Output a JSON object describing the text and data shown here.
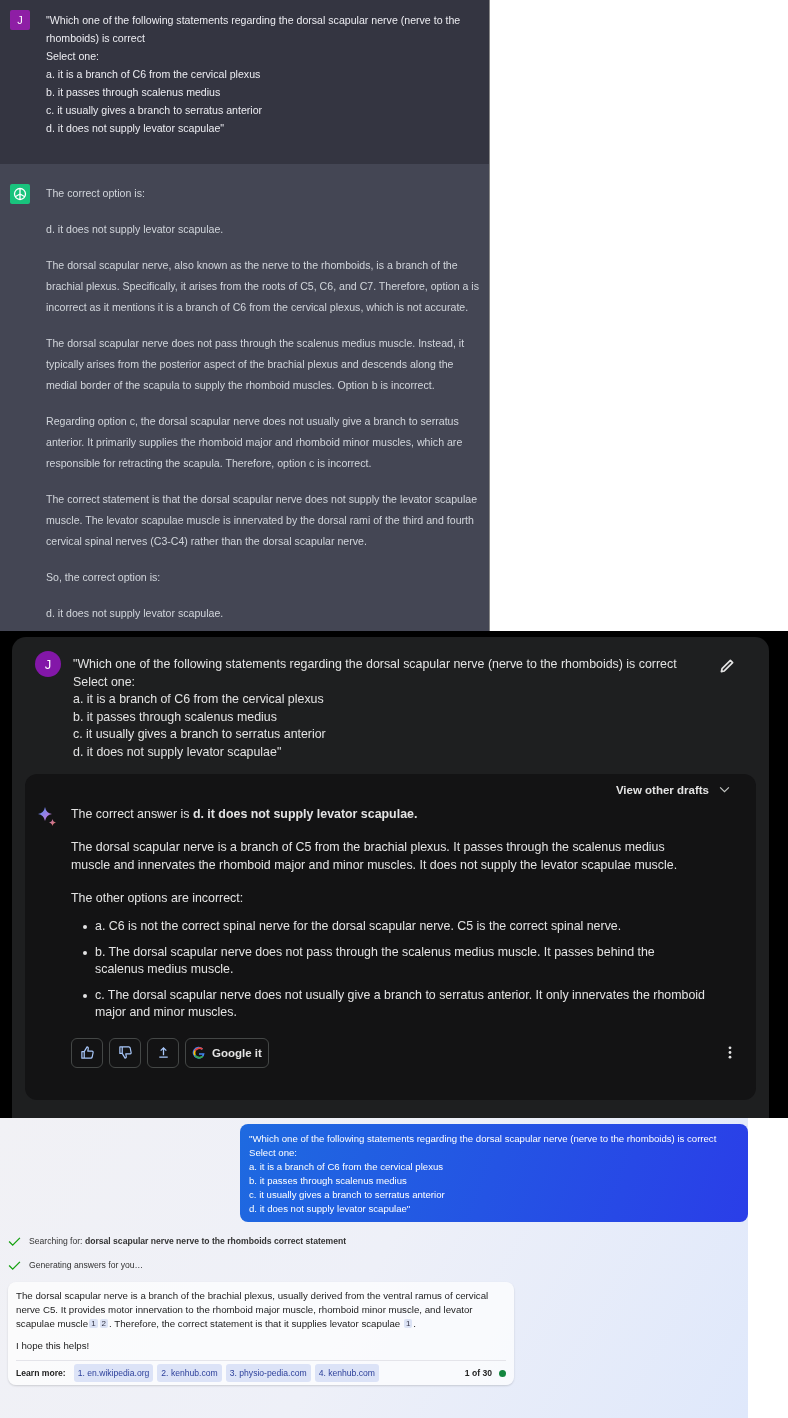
{
  "chatgpt": {
    "user": {
      "avatar": "J",
      "lines": [
        "\"Which one of the following statements regarding the dorsal scapular nerve (nerve to the rhomboids) is correct",
        "Select one:",
        "a. it is a branch of C6 from the cervical plexus",
        "b. it passes through scalenus medius",
        "c. it usually gives a branch to serratus anterior",
        "d. it does not supply levator scapulae\""
      ]
    },
    "answer": [
      "The correct option is:",
      "d. it does not supply levator scapulae.",
      "The dorsal scapular nerve, also known as the nerve to the rhomboids, is a branch of the brachial plexus. Specifically, it arises from the roots of C5, C6, and C7. Therefore, option a is incorrect as it mentions it is a branch of C6 from the cervical plexus, which is not accurate.",
      "The dorsal scapular nerve does not pass through the scalenus medius muscle. Instead, it typically arises from the posterior aspect of the brachial plexus and descends along the medial border of the scapula to supply the rhomboid muscles. Option b is incorrect.",
      "Regarding option c, the dorsal scapular nerve does not usually give a branch to serratus anterior. It primarily supplies the rhomboid major and rhomboid minor muscles, which are responsible for retracting the scapula. Therefore, option c is incorrect.",
      "The correct statement is that the dorsal scapular nerve does not supply the levator scapulae muscle. The levator scapulae muscle is innervated by the dorsal rami of the third and fourth cervical spinal nerves (C3-C4) rather than the dorsal scapular nerve.",
      "So, the correct option is:",
      "d. it does not supply levator scapulae."
    ]
  },
  "bard": {
    "user": {
      "avatar": "J",
      "lines": [
        "\"Which one of the following statements regarding the dorsal scapular nerve (nerve to the rhomboids) is correct",
        "Select one:",
        "a. it is a branch of C6 from the cervical plexus",
        "b. it passes through scalenus medius",
        "c. it usually gives a branch to serratus anterior",
        "d. it does not supply levator scapulae\""
      ]
    },
    "drafts_button": "View other drafts",
    "answer": {
      "lead": "The correct answer is **d. it does not supply levator scapulae.**",
      "paragraphs": [
        "The dorsal scapular nerve is a branch of C5 from the brachial plexus. It passes through the scalenus medius muscle and innervates the rhomboid major and minor muscles. It does not supply the levator scapulae muscle.",
        "The other options are incorrect:"
      ],
      "bullets": [
        "a. C6 is not the correct spinal nerve for the dorsal scapular nerve. C5 is the correct spinal nerve.",
        "b. The dorsal scapular nerve does not pass through the scalenus medius muscle. It passes behind the scalenus medius muscle.",
        "c. The dorsal scapular nerve does not usually give a branch to serratus anterior. It only innervates the rhomboid major and minor muscles."
      ]
    },
    "google_button": "Google it"
  },
  "bing": {
    "user": {
      "lines": [
        "\"Which one of the following statements regarding the dorsal scapular nerve (nerve to the rhomboids) is correct",
        "Select one:",
        "a. it is a branch of C6 from the cervical plexus",
        "b. it passes through scalenus medius",
        "c. it usually gives a branch to serratus anterior",
        "d. it does not supply levator scapulae\""
      ]
    },
    "progress": [
      "Searching for: **dorsal scapular nerve nerve to the rhomboids correct statement**",
      "Generating answers for you…"
    ],
    "answer": [
      {
        "kind": "text",
        "text": "The dorsal scapular nerve is a branch of the brachial plexus, usually derived from the ventral ramus of cervical nerve C5. It provides motor innervation to the rhomboid major muscle, rhomboid minor muscle, and levator scapulae muscle"
      },
      {
        "kind": "cite",
        "text": "1"
      },
      {
        "kind": "cite",
        "text": "2"
      },
      {
        "kind": "text",
        "text": ". Therefore, the correct statement is that it supplies levator scapulae "
      },
      {
        "kind": "cite",
        "text": "1"
      },
      {
        "kind": "text",
        "text": "."
      }
    ],
    "closing": "I hope this helps!",
    "learn_more": "Learn more:",
    "sources": [
      "1. en.wikipedia.org",
      "2. kenhub.com",
      "3. physio-pedia.com",
      "4. kenhub.com"
    ],
    "count": "1 of 30"
  }
}
